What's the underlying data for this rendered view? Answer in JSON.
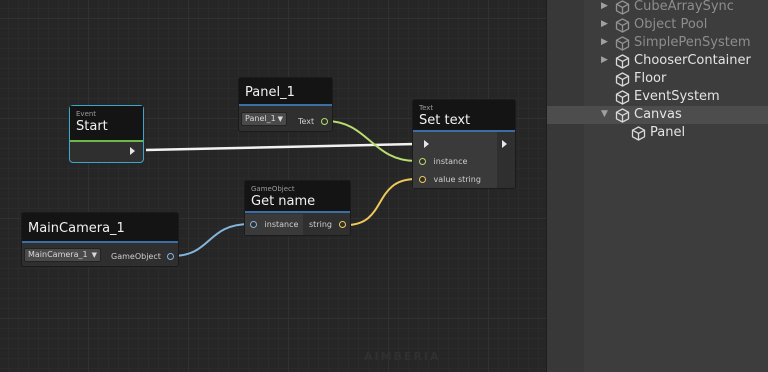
{
  "graph": {
    "watermark": "AIMBERIA",
    "nodes": {
      "start": {
        "category": "Event",
        "title": "Start"
      },
      "panel": {
        "title": "Panel_1",
        "dropdown": "Panel_1",
        "port_text": "Text"
      },
      "set_text": {
        "category": "Text",
        "title": "Set text",
        "port_instance": "instance",
        "port_value": "value string"
      },
      "get_name": {
        "category": "GameObject",
        "title": "Get name",
        "port_instance": "instance",
        "port_string": "string"
      },
      "camera": {
        "title": "MainCamera_1",
        "dropdown": "MainCamera_1",
        "port_out": "GameObject"
      }
    }
  },
  "hierarchy": {
    "items": [
      {
        "label": "CubeArraySync",
        "arrow": "▶",
        "dim": true
      },
      {
        "label": "Object Pool",
        "arrow": "▶",
        "dim": true
      },
      {
        "label": "SimplePenSystem",
        "arrow": "▶",
        "dim": true
      },
      {
        "label": "ChooserContainer",
        "arrow": "▶",
        "dim": false
      },
      {
        "label": "Floor",
        "arrow": "",
        "dim": false
      },
      {
        "label": "EventSystem",
        "arrow": "",
        "dim": false
      },
      {
        "label": "Canvas",
        "arrow": "▼",
        "dim": false,
        "selected": true
      },
      {
        "label": "Panel",
        "arrow": "",
        "dim": false,
        "child": true
      }
    ]
  },
  "colors": {
    "flow_wire": "#f2f2f2",
    "green_wire": "#b7de6e",
    "yellow_wire": "#f0c85a",
    "blue_wire": "#83b6dd",
    "selection": "#3ea6c9"
  }
}
